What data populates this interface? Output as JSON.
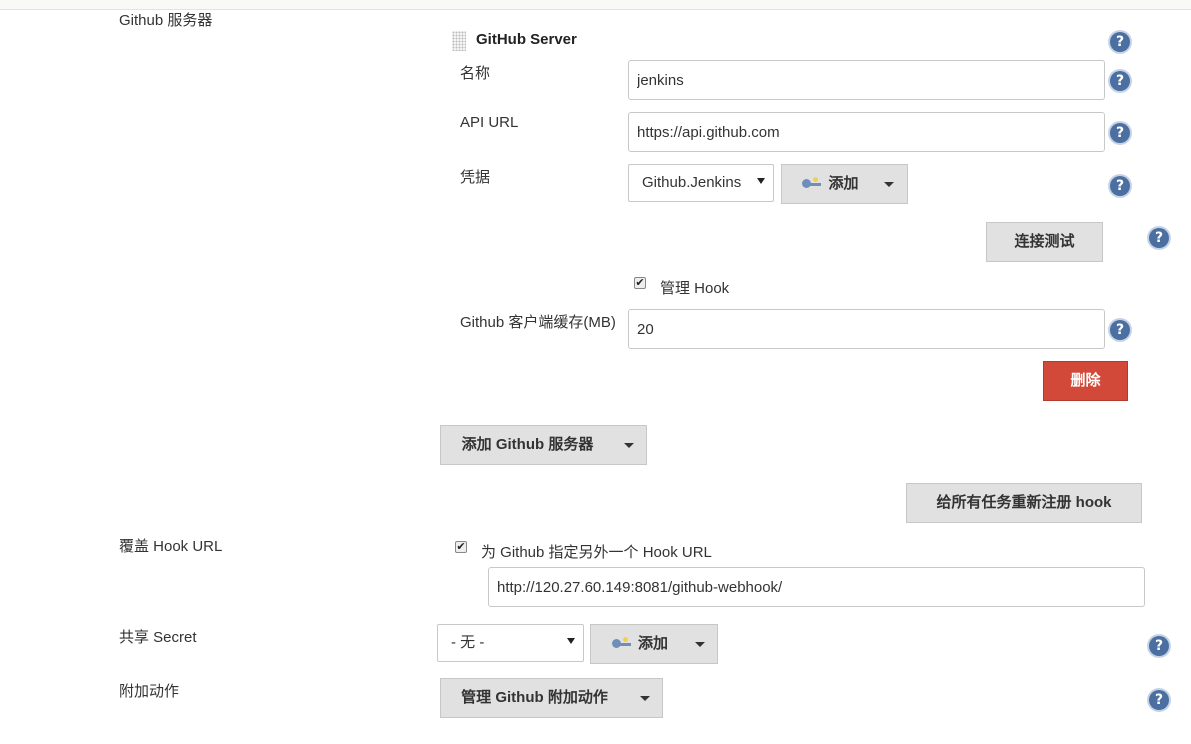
{
  "sections": {
    "github_servers": "Github 服务器",
    "override_hook": "覆盖 Hook URL",
    "shared_secret": "共享 Secret",
    "additional_actions": "附加动作"
  },
  "server": {
    "title": "GitHub Server",
    "name_label": "名称",
    "name_value": "jenkins",
    "api_url_label": "API URL",
    "api_url_value": "https://api.github.com",
    "credentials_label": "凭据",
    "credentials_selected": "Github.Jenkins",
    "add_label": "添加",
    "test_connection": "连接测试",
    "manage_hook_label": "管理 Hook",
    "manage_hook_checked": true,
    "cache_label": "Github 客户端缓存(MB)",
    "cache_value": "20",
    "delete_label": "删除"
  },
  "add_server_button": "添加 Github 服务器",
  "reregister_button": "给所有任务重新注册 hook",
  "override": {
    "checkbox_label": "为 Github 指定另外一个 Hook URL",
    "checked": true,
    "hook_url": "http://120.27.60.149:8081/github-webhook/"
  },
  "secret": {
    "selected": "- 无 -",
    "add_label": "添加"
  },
  "manage_actions_button": "管理 Github 附加动作",
  "help_symbol": "?",
  "check_symbol": "✔",
  "colors": {
    "delete_button": "#d24939",
    "help_icon": "#4a6fa0",
    "button_bg": "#e1e1e1"
  }
}
